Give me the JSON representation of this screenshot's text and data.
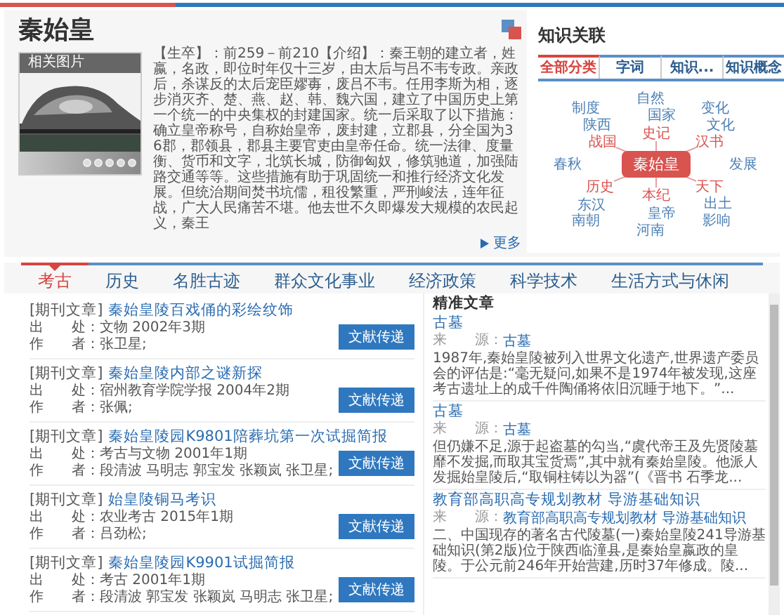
{
  "header": {
    "title": "秦始皇",
    "image_caption": "相关图片",
    "slides": [
      {
        "selected": false
      },
      {
        "selected": false
      },
      {
        "selected": false
      },
      {
        "selected": false
      },
      {
        "selected": false
      }
    ],
    "intro": "【生卒】：前259－前210【介绍】：秦王朝的建立者，姓嬴，名政，即位时年仅十三岁，由太后与吕不韦专政。亲政后，杀谋反的太后宠臣嫪毐，废吕不韦。任用李斯为相，逐步消灭齐、楚、燕、赵、韩、魏六国，建立了中国历史上第一个统一的中央集权的封建国家。统一后采取了以下措施：确立皇帝称号，自称始皇帝，废封建，立郡县，分全国为36郡，郡领县，郡县主要官吏由皇帝任命。统一法律、度量衡、货币和文字，北筑长城，防御匈奴，修筑驰道，加强陆路交通等等。这些措施有助于巩固统一和推行经济文化发展。但统治期间焚书坑儒，租役繁重，严刑峻法，连年征战，广大人民痛苦不堪。他去世不久即爆发大规模的农民起义，秦王",
    "more": "更多"
  },
  "knowledge": {
    "title": "知识关联",
    "tabs": [
      {
        "label": "全部分类",
        "selected": true
      },
      {
        "label": "字词",
        "selected": false
      },
      {
        "label": "知识...",
        "selected": false
      },
      {
        "label": "知识概念",
        "selected": false
      }
    ],
    "center": "秦始皇",
    "nodes": [
      {
        "label": "制度",
        "kind": "outer"
      },
      {
        "label": "自然",
        "kind": "outer"
      },
      {
        "label": "变化",
        "kind": "outer"
      },
      {
        "label": "国家",
        "kind": "outer"
      },
      {
        "label": "陕西",
        "kind": "outer"
      },
      {
        "label": "文化",
        "kind": "outer"
      },
      {
        "label": "史记",
        "kind": "inner"
      },
      {
        "label": "战国",
        "kind": "inner"
      },
      {
        "label": "汉书",
        "kind": "inner"
      },
      {
        "label": "春秋",
        "kind": "outer"
      },
      {
        "label": "发展",
        "kind": "outer"
      },
      {
        "label": "历史",
        "kind": "inner"
      },
      {
        "label": "天下",
        "kind": "inner"
      },
      {
        "label": "本纪",
        "kind": "inner"
      },
      {
        "label": "东汉",
        "kind": "outer"
      },
      {
        "label": "出土",
        "kind": "outer"
      },
      {
        "label": "南朝",
        "kind": "outer"
      },
      {
        "label": "皇帝",
        "kind": "outer"
      },
      {
        "label": "影响",
        "kind": "outer"
      },
      {
        "label": "河南",
        "kind": "outer"
      }
    ]
  },
  "nav_tabs": [
    {
      "label": "考古",
      "selected": true
    },
    {
      "label": "历史",
      "selected": false
    },
    {
      "label": "名胜古迹",
      "selected": false
    },
    {
      "label": "群众文化事业",
      "selected": false
    },
    {
      "label": "经济政策",
      "selected": false
    },
    {
      "label": "科学技术",
      "selected": false
    },
    {
      "label": "生活方式与休闲",
      "selected": false
    }
  ],
  "articles": [
    {
      "type": "[期刊文章]",
      "title": "秦始皇陵百戏俑的彩绘纹饰",
      "source_label": "出　　处：",
      "source": "文物 2002年3期",
      "author_label": "作　　者：",
      "authors": "张卫星;",
      "button": "文献传递"
    },
    {
      "type": "[期刊文章]",
      "title": "秦始皇陵内部之谜新探",
      "source_label": "出　　处：",
      "source": "宿州教育学院学报 2004年2期",
      "author_label": "作　　者：",
      "authors": "张佩;",
      "button": "文献传递"
    },
    {
      "type": "[期刊文章]",
      "title": "秦始皇陵园K9801陪葬坑第一次试掘简报",
      "source_label": "出　　处：",
      "source": "考古与文物 2001年1期",
      "author_label": "作　　者：",
      "authors": "段清波 马明志 郭宝发 张颖岚 张卫星;",
      "button": "文献传递"
    },
    {
      "type": "[期刊文章]",
      "title": "始皇陵铜马考识",
      "source_label": "出　　处：",
      "source": "农业考古 2015年1期",
      "author_label": "作　　者：",
      "authors": "吕劲松;",
      "button": "文献传递"
    },
    {
      "type": "[期刊文章]",
      "title": "秦始皇陵园K9901试掘简报",
      "source_label": "出　　处：",
      "source": "考古 2001年1期",
      "author_label": "作　　者：",
      "authors": "段清波 郭宝发 张颖岚 马明志 张卫星;",
      "button": "文献传递"
    }
  ],
  "sidebar": {
    "title": "精准文章",
    "items": [
      {
        "title": "古墓",
        "source_label": "来　　源：",
        "source": "古墓",
        "snippet": "1987年,秦始皇陵被列入世界文化遗产,世界遗产委员会的评估是:“毫无疑问,如果不是1974年被发现,这座考古遗址上的成千件陶俑将依旧沉睡于地下。”..."
      },
      {
        "title": "古墓",
        "source_label": "来　　源：",
        "source": "古墓",
        "snippet": "但仍嫌不足,源于起盗墓的勾当,“虞代帝王及先贤陵墓靡不发掘,而取其宝货焉”,其中就有秦始皇陵。他派人发掘始皇陵后,“取铜柱铸以为器”(《晋书 石季龙..."
      },
      {
        "title": "教育部高职高专规划教材 导游基础知识",
        "source_label": "来　　源：",
        "source": "教育部高职高专规划教材 导游基础知识",
        "snippet": "二、中国现存的著名古代陵墓(一)秦始皇陵241导游基础知识(第2版)位于陕西临潼县,是秦始皇嬴政的皇陵。于公元前246年开始营建,历时37年修成。陵..."
      }
    ]
  }
}
